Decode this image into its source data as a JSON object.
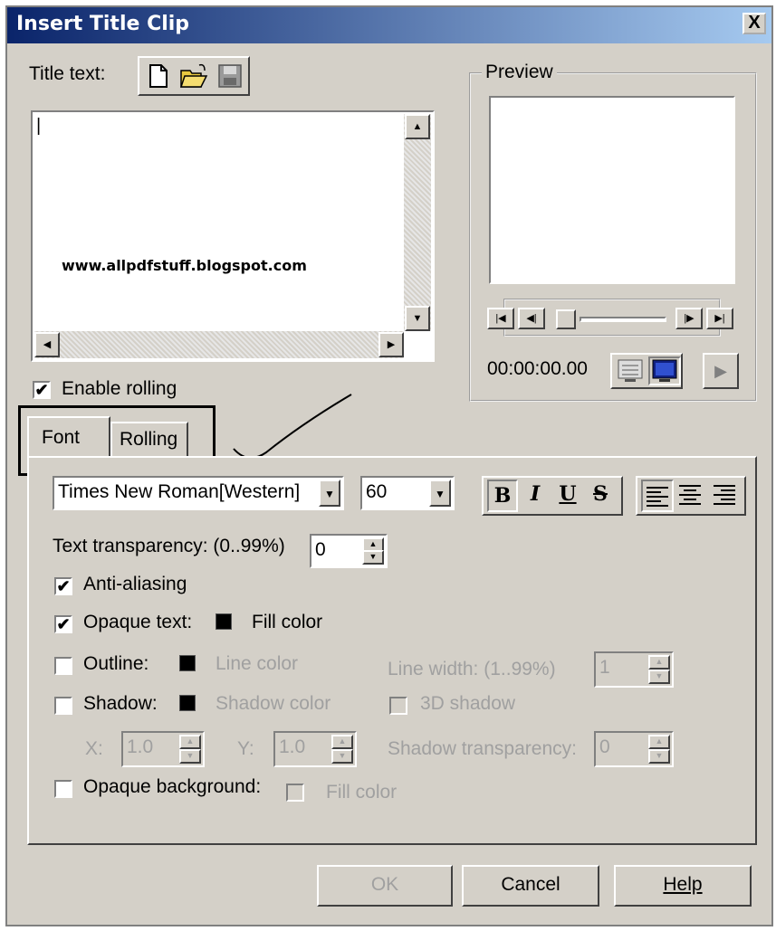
{
  "window": {
    "title": "Insert Title Clip",
    "close_glyph": "X"
  },
  "title_text": {
    "label": "Title text:",
    "value": "|",
    "toolbar_icons": [
      "new-document-icon",
      "open-folder-icon",
      "save-disk-icon"
    ],
    "watermark": "www.allpdfstuff.blogspot.com"
  },
  "enable_rolling": {
    "label": "Enable rolling",
    "checked": true
  },
  "tabs": [
    {
      "label": "Font",
      "active": true
    },
    {
      "label": "Rolling",
      "active": false
    }
  ],
  "preview": {
    "label": "Preview",
    "timecode": "00:00:00.00"
  },
  "font": {
    "family": "Times New Roman[Western]",
    "size": "60",
    "style_buttons": [
      "B",
      "I",
      "U",
      "S"
    ],
    "align_icons": [
      "align-left-icon",
      "align-center-icon",
      "align-right-icon"
    ],
    "transparency_label": "Text transparency: (0..99%)",
    "transparency_value": "0",
    "anti_aliasing": {
      "label": "Anti-aliasing",
      "checked": true
    },
    "opaque_text": {
      "label": "Opaque text:",
      "checked": true,
      "color_label": "Fill color",
      "color": "#000000"
    },
    "outline": {
      "label": "Outline:",
      "checked": false,
      "color_label": "Line color",
      "width_label": "Line width: (1..99%)",
      "width_value": "1"
    },
    "shadow": {
      "label": "Shadow:",
      "checked": false,
      "color_label": "Shadow color",
      "three_d_label": "3D shadow",
      "x_label": "X:",
      "x_value": "1.0",
      "y_label": "Y:",
      "y_value": "1.0",
      "transparency_label": "Shadow transparency:",
      "transparency_value": "0"
    },
    "opaque_background": {
      "label": "Opaque background:",
      "checked": false,
      "fill_label": "Fill color"
    }
  },
  "buttons": {
    "ok": "OK",
    "cancel": "Cancel",
    "help": "Help"
  }
}
